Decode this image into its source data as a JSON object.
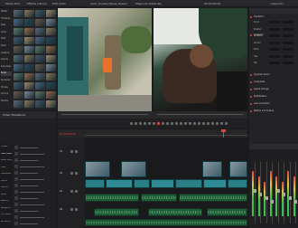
{
  "toolbar": {
    "media_pool": "Media Pool",
    "effects": "Effects Library",
    "edit_index": "Edit Index",
    "clip_name": "Avon_Sunset_Tapes_Desert",
    "project": "Magnolia Yesterday",
    "inspector": "Inspector",
    "timecode_viewer": "00:00:00:00"
  },
  "media_pool": {
    "bins": [
      "Master",
      "Timelines",
      "Clips",
      "Audio",
      "Stills",
      "Music",
      "Graphics",
      "Selects",
      "Interviews",
      "B-roll",
      "Rendered",
      "Proxies",
      "Archive",
      "Exports"
    ],
    "selected_bin": "B-roll"
  },
  "effects": {
    "header": "Video Transitions",
    "categories": [
      "Toolbox",
      "Video Transitions",
      "Audio Transitions",
      "Titles",
      "Generators",
      "Effects",
      "Open FX",
      "Filters",
      "Audio FX",
      "Fairlight FX",
      "VST Effects",
      "AU Effects"
    ]
  },
  "timeline": {
    "timecode": "01:00:00:00",
    "tracks": [
      "V1",
      "V2",
      "A1",
      "A2"
    ]
  },
  "inspector": {
    "sections": [
      "Transform",
      "Cropping",
      "Dynamic Zoom",
      "Composite",
      "Speed Change",
      "Stabilization",
      "Lens Correction",
      "Retime and Scaling"
    ],
    "fields": [
      "Zoom",
      "Position",
      "Rotation",
      "Anchor",
      "Pitch",
      "Yaw",
      "Flip"
    ]
  },
  "colors": {
    "accent": "#e5413b",
    "clip": "#2f8b93",
    "audio": "#1f5a36"
  }
}
